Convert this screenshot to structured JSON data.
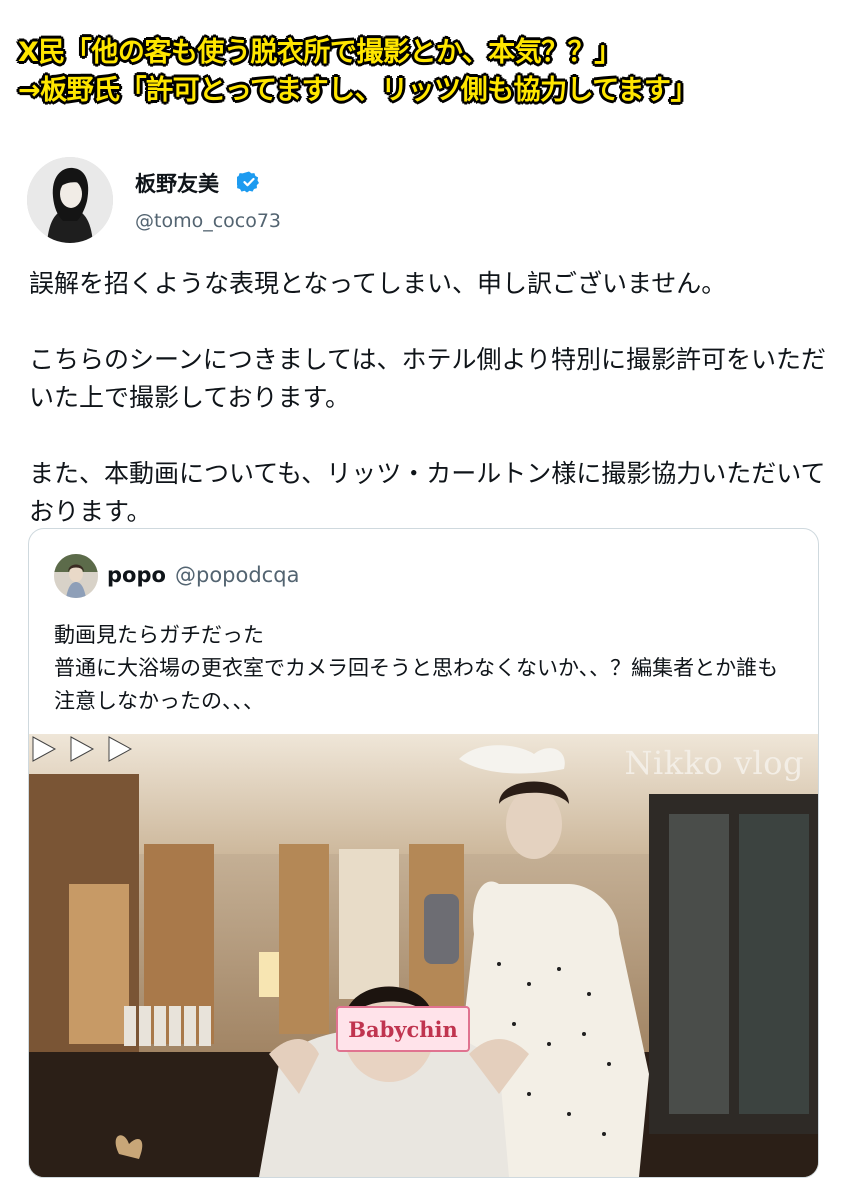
{
  "banner": {
    "line1": "X民「他の客も使う脱衣所で撮影とか、本気？？」",
    "line2": "→板野氏「許可とってますし、リッツ側も協力してます」"
  },
  "tweet": {
    "author_name": "板野友美",
    "author_handle": "@tomo_coco73",
    "verified": true,
    "paragraphs": [
      "誤解を招くような表現となってしまい、申し訳ございません。",
      "こちらのシーンにつきましては、ホテル側より特別に撮影許可をいただいた上で撮影しております。",
      "また、本動画についても、リッツ・カールトン様に撮影協力いただいております。"
    ]
  },
  "quote": {
    "author_name": "popo",
    "author_handle": "@popodcqa",
    "lines": [
      "動画見たらガチだった",
      "普通に大浴場の更衣室でカメラ回そうと思わなくないか、、？編集者とか誰も注意しなかったの、、、"
    ],
    "media": {
      "watermark": "Nikko vlog",
      "sticker_label": "Babychin"
    }
  },
  "colors": {
    "banner_text": "#ffe600",
    "banner_outline": "#000000",
    "verified_blue": "#1d9bf0",
    "handle_gray": "#536471",
    "border": "#cfd9de"
  },
  "icons": [
    "verified-badge-icon",
    "play-arrows-icon"
  ]
}
